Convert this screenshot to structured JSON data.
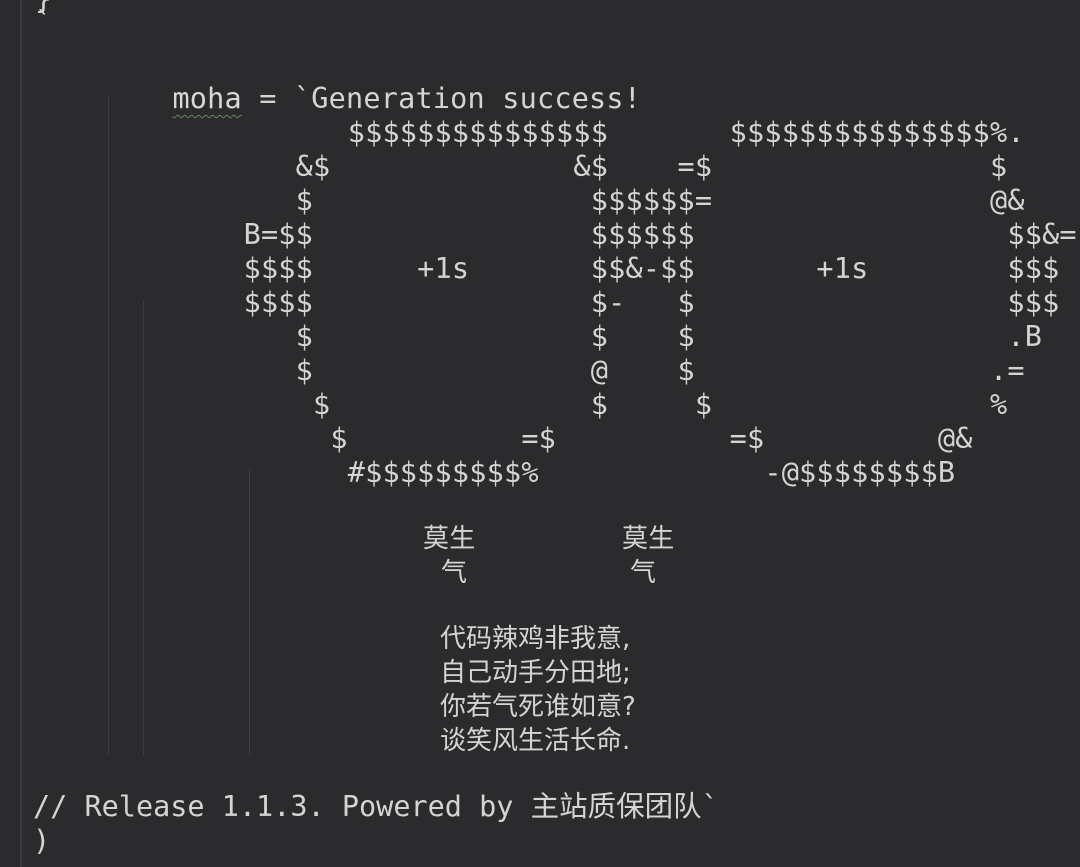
{
  "editor": {
    "top_fragment": "}",
    "backtick": "`",
    "assignment": {
      "variable": "moha",
      "operator": " = ",
      "string_open": "`Generation success!"
    },
    "ascii_art": [
      "                $$$$$$$$$$$$$$$       $$$$$$$$$$$$$$$%.",
      "             &$              &$    =$                $",
      "             $                $$$$$$=                @&",
      "          B=$$                $$$$$$                  $$&=",
      "          $$$$      +1s       $$&-$$       +1s        $$$",
      "          $$$$                $-   $                  $$$",
      "             $                $    $                  .B",
      "             $                @    $                 .=",
      "              $               $     $                %",
      "               $          =$          =$          @&",
      "                #$$$$$$$$$%             -@$$$$$$$$B"
    ],
    "signature": {
      "left_top": "莫生",
      "left_bottom": "气",
      "right_top": "莫生",
      "right_bottom": "气"
    },
    "poem": [
      "代码辣鸡非我意,",
      "自己动手分田地;",
      "你若气死谁如意?",
      "谈笑风生活长命."
    ],
    "release_comment": "// Release 1.1.3. Powered by 主站质保团队`",
    "closing_paren": ")"
  },
  "colors": {
    "background": "#2b2b2d",
    "text": "#d4d4d4",
    "indent_guide": "#3e3e42",
    "spell_underline": "#6a8759"
  }
}
